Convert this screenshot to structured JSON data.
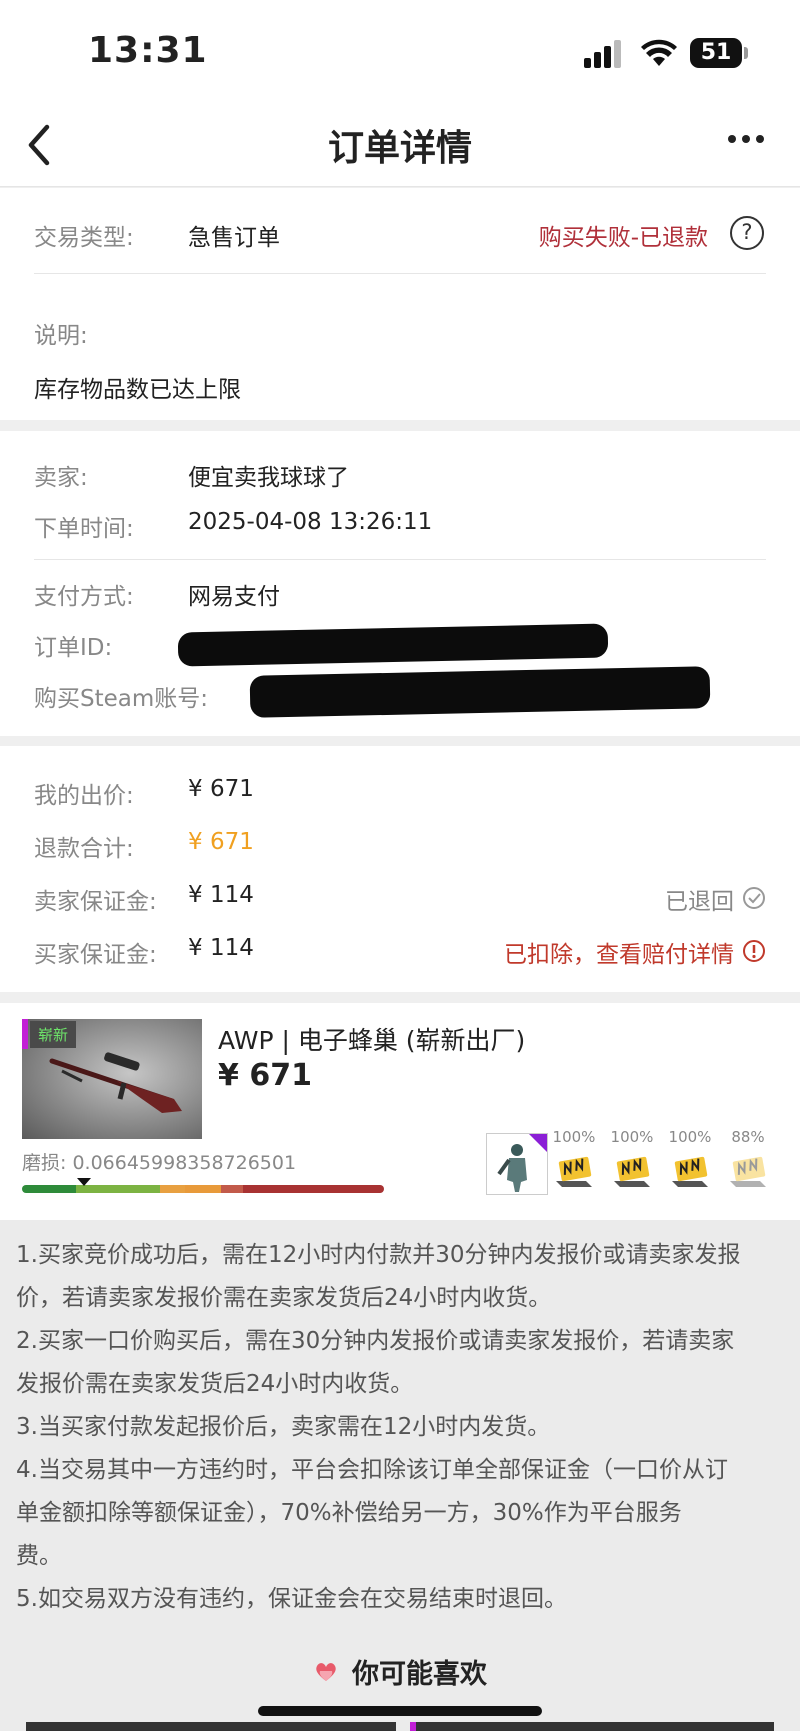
{
  "status_bar": {
    "time": "13:31",
    "battery": "51"
  },
  "nav": {
    "title": "订单详情"
  },
  "trade": {
    "type_label": "交易类型:",
    "type_value": "急售订单",
    "status": "购买失败-已退款",
    "help": "?",
    "note_label": "说明:",
    "note_value": "库存物品数已达上限"
  },
  "order": {
    "seller_label": "卖家:",
    "seller_value": "便宜卖我球球了",
    "time_label": "下单时间:",
    "time_value": "2025-04-08 13:26:11",
    "pay_label": "支付方式:",
    "pay_value": "网易支付",
    "order_id_label": "订单ID:",
    "steam_label": "购买Steam账号:"
  },
  "money": {
    "bid_label": "我的出价:",
    "bid_value": "¥ 671",
    "refund_label": "退款合计:",
    "refund_value": "¥ 671",
    "seller_deposit_label": "卖家保证金:",
    "seller_deposit_value": "¥ 114",
    "seller_deposit_status": "已退回",
    "buyer_deposit_label": "买家保证金:",
    "buyer_deposit_value": "¥ 114",
    "buyer_deposit_status": "已扣除，查看赔付详情",
    "colors": {
      "refund": "#f0a020",
      "status_red": "#c0392b"
    }
  },
  "item": {
    "badge": "崭新",
    "name": "AWP | 电子蜂巢 (崭新出厂)",
    "price": "¥ 671",
    "wear": "磨损: 0.06645998358726501",
    "wear_fraction": 0.066,
    "sticker_wear": [
      "100%",
      "100%",
      "100%",
      "88%"
    ],
    "sticker_icons": [
      "agent-icon",
      "navi-sticker-icon",
      "navi-sticker-icon",
      "navi-sticker-icon",
      "navi-sticker-icon"
    ]
  },
  "tips": [
    "1.买家竞价成功后，需在12小时内付款并30分钟内发报价或请卖家发报",
    "价，若请卖家发报价需在卖家发货后24小时内收货。",
    "2.买家一口价购买后，需在30分钟内发报价或请卖家发报价，若请卖家",
    "发报价需在卖家发货后24小时内收货。",
    "3.当买家付款发起报价后，卖家需在12小时内发货。",
    "4.当交易其中一方违约时，平台会扣除该订单全部保证金（一口价从订",
    "单金额扣除等额保证金），70%补偿给另一方，30%作为平台服务",
    "费。",
    "5.如交易双方没有违约，保证金会在交易结束时退回。"
  ],
  "recommend": {
    "title": "你可能喜欢"
  }
}
